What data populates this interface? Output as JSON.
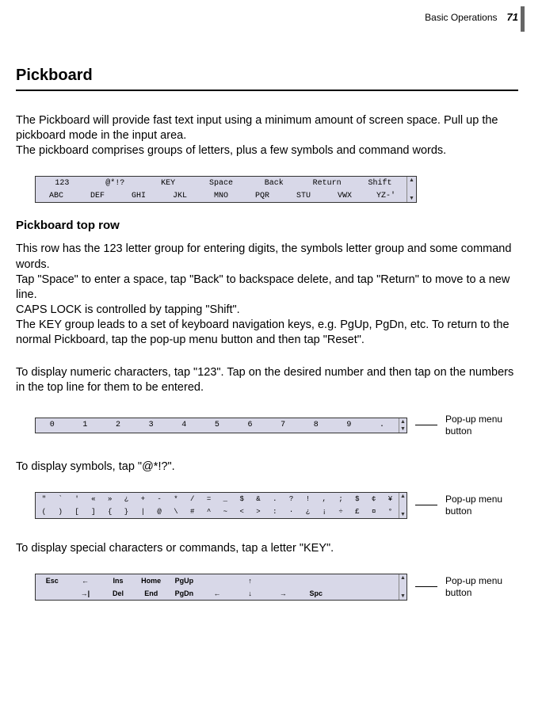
{
  "header": {
    "section": "Basic Operations",
    "page": "71"
  },
  "title": "Pickboard",
  "intro": [
    "The Pickboard will provide fast text input using a minimum amount of screen space. Pull up the pickboard mode in the input area.",
    "The pickboard comprises groups of letters, plus a few symbols and command words."
  ],
  "kb_main": {
    "row1": [
      "123",
      "@*!?",
      "KEY",
      "Space",
      "Back",
      "Return",
      "Shift"
    ],
    "row2": [
      "ABC",
      "DEF",
      "GHI",
      "JKL",
      "MNO",
      "PQR",
      "STU",
      "VWX",
      "YZ-'"
    ]
  },
  "sec2_title": "Pickboard top row",
  "sec2_paras": [
    "This row has the 123 letter group for entering digits, the symbols letter group and some command words.",
    "Tap \"Space\" to enter a space, tap \"Back\" to backspace delete, and tap \"Return\" to move to a new line.",
    "CAPS LOCK is controlled by tapping \"Shift\".",
    "The KEY group leads to a set of keyboard navigation keys, e.g. PgUp, PgDn, etc. To return to the normal Pickboard, tap the pop-up menu button and then tap \"Reset\"."
  ],
  "numeric_para": "To display numeric characters, tap \"123\". Tap on the desired number and then tap on the numbers in the top line for them to be entered.",
  "kb_numeric": [
    "0",
    "1",
    "2",
    "3",
    "4",
    "5",
    "6",
    "7",
    "8",
    "9",
    "."
  ],
  "symbols_para": "To display symbols, tap \"@*!?\".",
  "kb_symbols": {
    "row1": [
      "\"",
      "`",
      "'",
      "«",
      "»",
      "¿",
      "+",
      "-",
      "*",
      "/",
      "=",
      "_",
      "$",
      "&",
      ".",
      "?",
      "!",
      ",",
      ";",
      "$",
      "¢",
      "¥"
    ],
    "row2": [
      "(",
      ")",
      "[",
      "]",
      "{",
      "}",
      "|",
      "@",
      "\\",
      "#",
      "^",
      "~",
      "<",
      ">",
      ":",
      "·",
      "¿",
      "¡",
      "÷",
      "£",
      "¤",
      "°"
    ]
  },
  "key_para": "To display special characters or commands, tap a letter \"KEY\".",
  "kb_key": {
    "row1": [
      "Esc",
      "←",
      "Ins",
      "Home",
      "PgUp",
      "",
      "↑",
      "",
      "",
      "",
      ""
    ],
    "row2": [
      "",
      "→|",
      "Del",
      "End",
      "PgDn",
      "←",
      "↓",
      "→",
      "Spc",
      "",
      ""
    ]
  },
  "callout": "Pop-up menu\nbutton",
  "thumb": {
    "up": "▲",
    "down": "▼"
  }
}
